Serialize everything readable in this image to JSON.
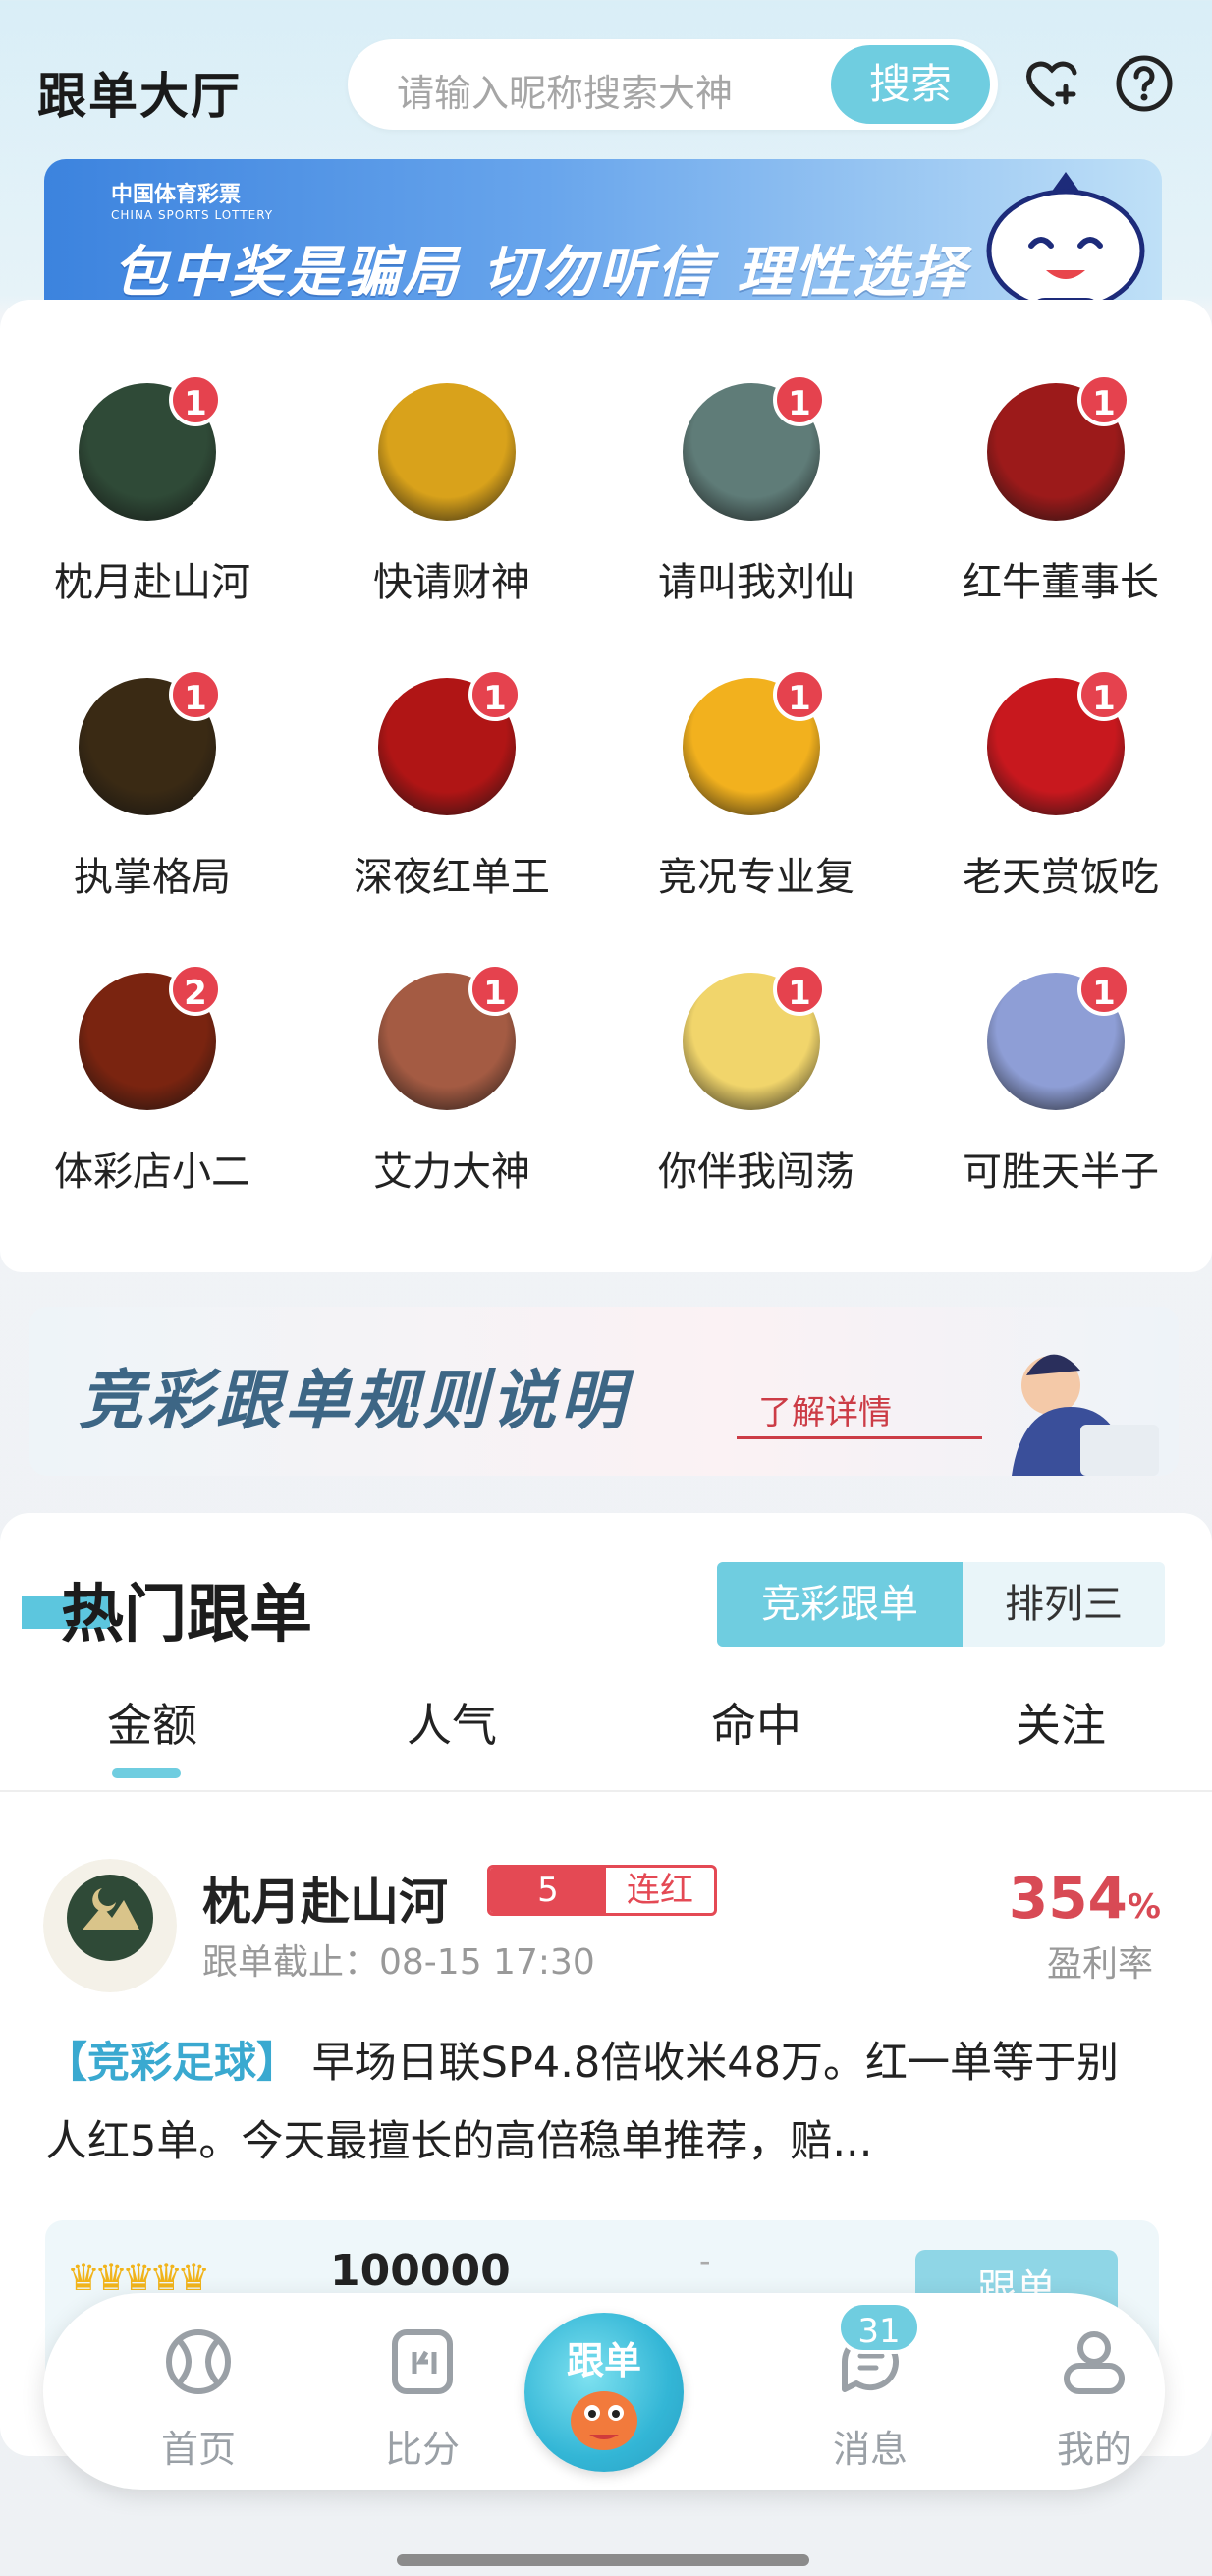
{
  "header": {
    "title": "跟单大厅",
    "search_placeholder": "请输入昵称搜索大神",
    "search_button": "搜索"
  },
  "banner_top": {
    "logo_text": "中国体育彩票",
    "logo_sub": "CHINA SPORTS LOTTERY",
    "slogan": "包中奖是骗局 切勿听信 理性选择"
  },
  "experts": [
    {
      "name": "枕月赴山河",
      "badge": "1",
      "avatar_color": "#2f4a37"
    },
    {
      "name": "快请财神",
      "badge": "",
      "avatar_color": "#d9a21b"
    },
    {
      "name": "请叫我刘仙",
      "badge": "1",
      "avatar_color": "#5f7c78"
    },
    {
      "name": "红牛董事长",
      "badge": "1",
      "avatar_color": "#9c1a1a"
    },
    {
      "name": "执掌格局",
      "badge": "1",
      "avatar_color": "#3a2a14"
    },
    {
      "name": "深夜红单王",
      "badge": "1",
      "avatar_color": "#b01515"
    },
    {
      "name": "竞况专业复",
      "badge": "1",
      "avatar_color": "#f2b11e"
    },
    {
      "name": "老天赏饭吃",
      "badge": "1",
      "avatar_color": "#c8181e"
    },
    {
      "name": "体彩店小二",
      "badge": "2",
      "avatar_color": "#7a2410"
    },
    {
      "name": "艾力大神",
      "badge": "1",
      "avatar_color": "#a45b43"
    },
    {
      "name": "你伴我闯荡",
      "badge": "1",
      "avatar_color": "#f1d56b"
    },
    {
      "name": "可胜天半子",
      "badge": "1",
      "avatar_color": "#8e9ed6"
    }
  ],
  "rules_banner": {
    "title": "竞彩跟单规则说明",
    "link": "了解详情"
  },
  "hot": {
    "title": "热门跟单",
    "segments": [
      "竞彩跟单",
      "排列三"
    ],
    "tabs": [
      "金额",
      "人气",
      "命中",
      "关注"
    ],
    "post": {
      "name": "枕月赴山河",
      "streak_count": "5",
      "streak_label": "连红",
      "deadline": "跟单截止：08-15 17:30",
      "rate": "354",
      "rate_unit": "%",
      "rate_label": "盈利率",
      "tag": "【竞彩足球】",
      "text": "早场日联SP4.8倍收米48万。红一单等于别人红5单。今天最擅长的高倍稳单推荐，赔...",
      "amount": "100000",
      "dash": "-",
      "action": "跟单"
    }
  },
  "nav": {
    "items": [
      "首页",
      "比分",
      "跟单",
      "消息",
      "我的"
    ],
    "msg_badge": "31"
  },
  "colors": {
    "accent": "#6fcde0",
    "badge_red": "#e5424e",
    "rate_red": "#d84a55"
  }
}
